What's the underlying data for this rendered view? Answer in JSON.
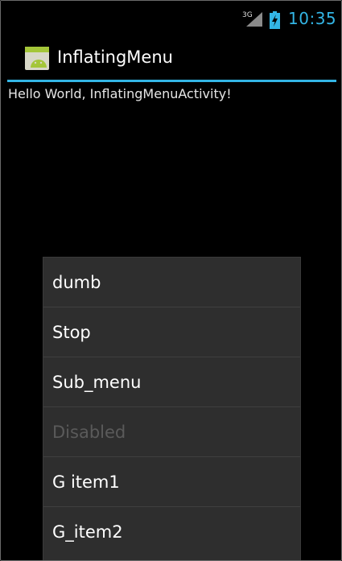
{
  "status_bar": {
    "network_type": "3G",
    "signal_icon": "signal-icon",
    "battery_icon": "battery-charging-icon",
    "time": "10:35",
    "clock_color": "#33b5e5"
  },
  "action_bar": {
    "app_icon": "android-app-icon",
    "title": "InflatingMenu",
    "divider_color": "#33b5e5"
  },
  "content": {
    "hello_text": "Hello World, InflatingMenuActivity!"
  },
  "menu": {
    "items": [
      {
        "label": "dumb",
        "enabled": true
      },
      {
        "label": "Stop",
        "enabled": true
      },
      {
        "label": "Sub_menu",
        "enabled": true
      },
      {
        "label": "Disabled",
        "enabled": false
      },
      {
        "label": "G item1",
        "enabled": true
      },
      {
        "label": "G_item2",
        "enabled": true
      }
    ]
  }
}
